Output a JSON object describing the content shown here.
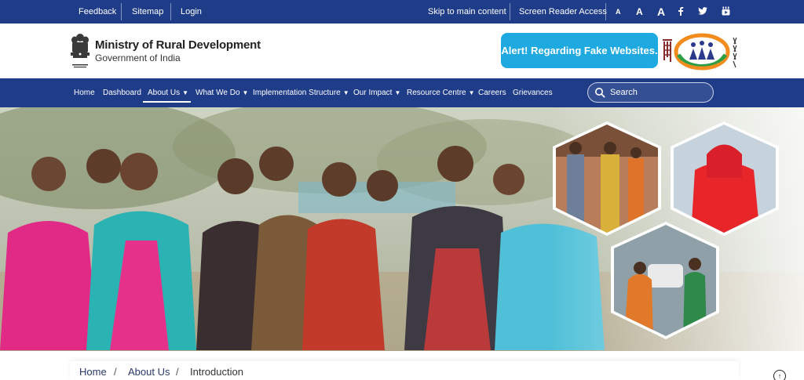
{
  "topbar": {
    "links": [
      "Feedback",
      "Sitemap",
      "Login"
    ],
    "skip_link": "Skip to main content",
    "screen_reader": "Screen Reader Access",
    "font_sizes": [
      "A",
      "A",
      "A"
    ],
    "social_icons": [
      "facebook-icon",
      "twitter-icon",
      "youtube-icon"
    ]
  },
  "header": {
    "title": "Ministry of Rural Development",
    "subtitle": "Government of India",
    "alert_button": "Alert! Regarding Fake Websites."
  },
  "nav": {
    "items": [
      {
        "label": "Home",
        "dropdown": false
      },
      {
        "label": "Dashboard",
        "dropdown": false
      },
      {
        "label": "About Us",
        "dropdown": true,
        "active": true
      },
      {
        "label": "What We Do",
        "dropdown": true
      },
      {
        "label": "Implementation Structure",
        "dropdown": true
      },
      {
        "label": "Our Impact",
        "dropdown": true
      },
      {
        "label": "Resource Centre",
        "dropdown": true
      },
      {
        "label": "Careers",
        "dropdown": false
      },
      {
        "label": "Grievances",
        "dropdown": false
      }
    ],
    "search_placeholder": "Search"
  },
  "breadcrumb": {
    "items": [
      "Home",
      "About Us",
      "Introduction"
    ],
    "separator": "/"
  },
  "colors": {
    "primary_blue": "#1f3c88",
    "alert_blue": "#1ea9e1"
  }
}
